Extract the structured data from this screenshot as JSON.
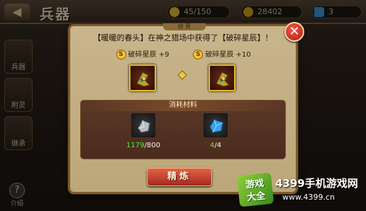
{
  "background": {
    "title": "兵器",
    "back_icon": "back-arrow-icon",
    "stamina": "45/150",
    "gold": "28402",
    "gems": "3",
    "side_tabs": [
      "兵器",
      "附灵",
      "继承"
    ],
    "help_label": "介绍"
  },
  "dialog": {
    "header_tab": "结 算",
    "message": "【暖暖的春头】在神之猎场中获得了【破碎星辰】！",
    "before": {
      "badge": "S",
      "name": "破碎星辰 +9"
    },
    "after": {
      "badge": "S",
      "name": "破碎星辰 +10"
    },
    "materials_title": "消耗材料",
    "materials": [
      {
        "icon": "silver-ore-icon",
        "have": "1179",
        "need": "/800"
      },
      {
        "icon": "blue-crystal-icon",
        "have": "4",
        "need": "/4"
      }
    ],
    "action_label": "精炼",
    "close_icon": "close-icon"
  },
  "watermark": {
    "logo_line1": "游戏",
    "logo_line2": "大全",
    "site_name": "4399手机游戏网",
    "url": "www.4399.cn"
  },
  "colors": {
    "dialog_bg": "#c9b58c",
    "button_red": "#c8402e",
    "have_green": "#5fe04a",
    "item_border": "#e7b52a"
  }
}
